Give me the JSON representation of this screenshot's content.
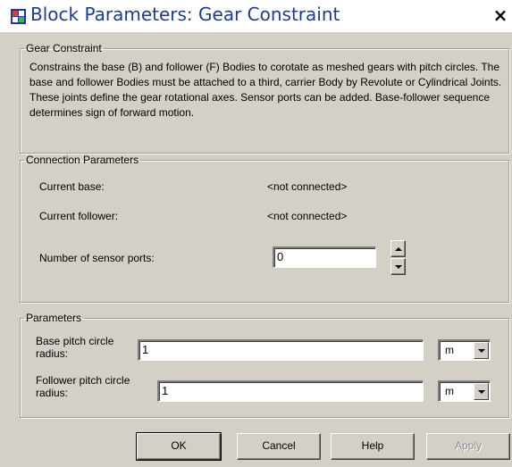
{
  "window": {
    "title": "Block Parameters: Gear Constraint",
    "close_glyph": "×",
    "icon": "simulink-block-icon"
  },
  "description_group": {
    "legend": "Gear Constraint",
    "text": "Constrains the base (B) and follower (F) Bodies to corotate as meshed gears with pitch circles. The base and follower Bodies must be attached to a third, carrier Body by Revolute or Cylindrical Joints. These joints define the gear rotational axes. Sensor ports can be added. Base-follower sequence determines sign of forward motion."
  },
  "connection": {
    "legend": "Connection Parameters",
    "current_base_label": "Current base:",
    "current_base_value": "<not connected>",
    "current_follower_label": "Current follower:",
    "current_follower_value": "<not connected>",
    "sensor_ports_label": "Number of sensor ports:",
    "sensor_ports_value": "0"
  },
  "parameters": {
    "legend": "Parameters",
    "base_radius_label": "Base pitch circle radius:",
    "base_radius_value": "1",
    "base_radius_unit": "m",
    "follower_radius_label": "Follower pitch circle radius:",
    "follower_radius_value": "1",
    "follower_radius_unit": "m"
  },
  "buttons": {
    "ok": "OK",
    "cancel": "Cancel",
    "help": "Help",
    "apply": "Apply"
  },
  "colors": {
    "dialog_bg": "#d4d0c8",
    "title_text": "#1f3c88",
    "disabled_text": "#8d8d8d"
  }
}
